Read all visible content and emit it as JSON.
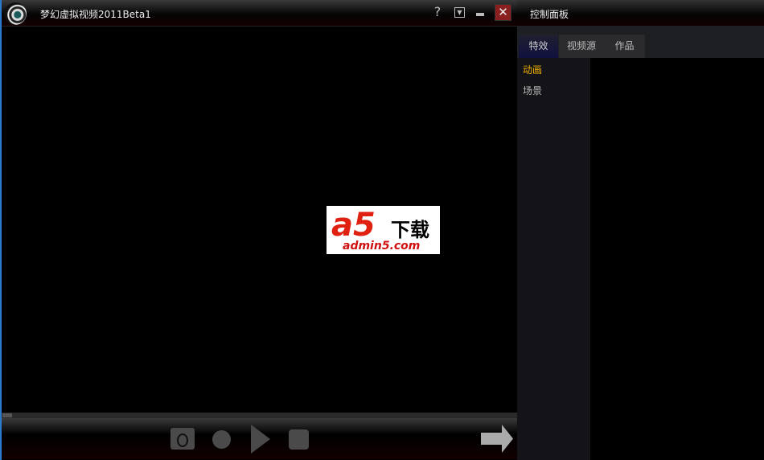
{
  "window": {
    "title": "梦幻虚拟视频2011Beta1",
    "help": "?",
    "menu": "▼",
    "close": "✕"
  },
  "logo": {
    "mark": "a5",
    "text": "下载",
    "url": "admin5.com"
  },
  "panel": {
    "title": "控制面板",
    "tabs": [
      {
        "label": "特效"
      },
      {
        "label": "视频源"
      },
      {
        "label": "作品"
      }
    ],
    "items": [
      {
        "label": "动画"
      },
      {
        "label": "场景"
      }
    ]
  }
}
